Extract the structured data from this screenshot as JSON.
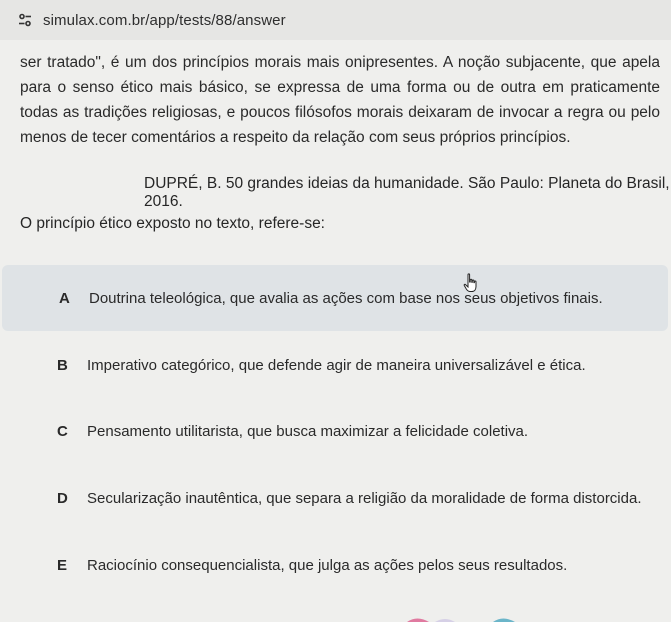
{
  "browser": {
    "url": "simulax.com.br/app/tests/88/answer",
    "site_icon": "tune-settings-icon"
  },
  "passage": {
    "text": "ser tratado\", é um dos princípios morais mais onipresentes. A noção subjacente, que apela para o senso ético mais básico, se expressa de uma forma ou de outra em praticamente todas as tradições religiosas, e poucos filósofos morais deixaram de invocar a regra ou pelo menos de tecer comentários a respeito da relação com seus próprios princípios."
  },
  "citation": "DUPRÉ, B. 50 grandes ideias da humanidade. São Paulo: Planeta do Brasil, 2016.",
  "question": "O princípio ético exposto no texto, refere-se:",
  "options": [
    {
      "letter": "A",
      "text": "Doutrina teleológica, que avalia as ações com base nos seus objetivos finais."
    },
    {
      "letter": "B",
      "text": "Imperativo categórico, que defende agir de maneira universalizável e ética."
    },
    {
      "letter": "C",
      "text": "Pensamento utilitarista, que busca maximizar a felicidade coletiva."
    },
    {
      "letter": "D",
      "text": "Secularização inautêntica, que separa a religião da moralidade de forma distorcida."
    },
    {
      "letter": "E",
      "text": "Raciocínio consequencialista, que julga as ações pelos seus resultados."
    }
  ],
  "colors": {
    "highlight": "#dfe3e6",
    "background": "#efefed"
  }
}
